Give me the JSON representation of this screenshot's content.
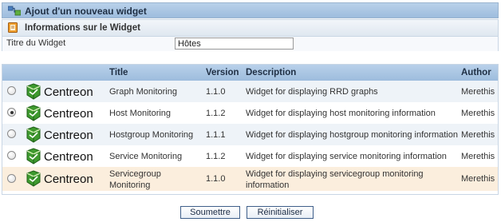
{
  "header": {
    "title": "Ajout d'un nouveau widget",
    "icon": "widget-icon"
  },
  "info": {
    "section_title": "Informations sur le Widget",
    "section_icon": "info-book-icon",
    "field_label": "Titre du Widget",
    "field_value": "Hôtes"
  },
  "table": {
    "columns": {
      "title": "Title",
      "version": "Version",
      "description": "Description",
      "author": "Author"
    },
    "rows": [
      {
        "logo": "Centreon",
        "title": "Graph Monitoring",
        "version": "1.1.0",
        "description": "Widget for displaying RRD graphs",
        "author": "Merethis",
        "selected": false
      },
      {
        "logo": "Centreon",
        "title": "Host Monitoring",
        "version": "1.1.2",
        "description": "Widget for displaying host monitoring information",
        "author": "Merethis",
        "selected": true
      },
      {
        "logo": "Centreon",
        "title": "Hostgroup Monitoring",
        "version": "1.1.1",
        "description": "Widget for displaying hostgroup monitoring information",
        "author": "Merethis",
        "selected": false
      },
      {
        "logo": "Centreon",
        "title": "Service Monitoring",
        "version": "1.1.2",
        "description": "Widget for displaying service monitoring information",
        "author": "Merethis",
        "selected": false
      },
      {
        "logo": "Centreon",
        "title_line1": "Servicegroup",
        "title_line2": "Monitoring",
        "version": "1.1.0",
        "description_line1": "Widget for displaying servicegroup monitoring",
        "description_line2": "information",
        "author": "Merethis",
        "selected": false
      }
    ]
  },
  "buttons": {
    "submit": "Soumettre",
    "reset": "Réinitialiser"
  },
  "colors": {
    "header_bg": "#a9c6e4",
    "row_alt": "#eef3f8",
    "row_highlight": "#fbeedd",
    "logo_green": "#3f9a2f"
  }
}
